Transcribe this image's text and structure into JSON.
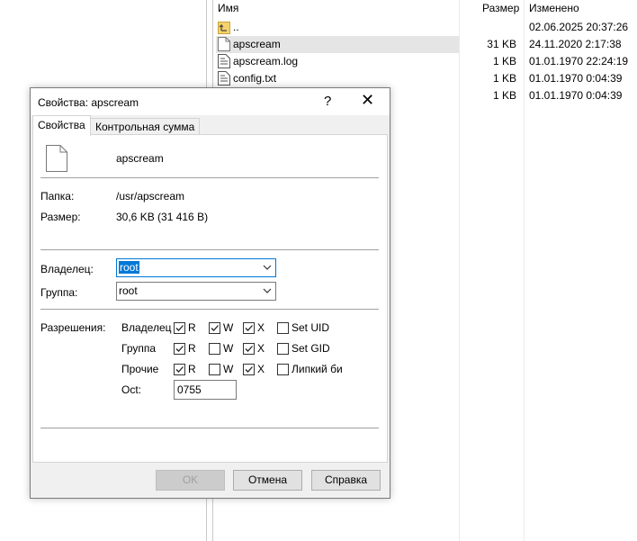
{
  "file_panel": {
    "headers": {
      "name": "Имя",
      "size": "Размер",
      "modified": "Изменено"
    },
    "files": [
      {
        "name": "..",
        "size": "",
        "modified": "02.06.2025 20:37:26",
        "icon": "parent-folder-icon"
      },
      {
        "name": "apscream",
        "size": "31 KB",
        "modified": "24.11.2020 2:17:38",
        "icon": "file-icon",
        "selected": true
      },
      {
        "name": "apscream.log",
        "size": "1 KB",
        "modified": "01.01.1970 22:24:19",
        "icon": "log-file-icon"
      },
      {
        "name": "config.txt",
        "size": "1 KB",
        "modified": "01.01.1970 0:04:39",
        "icon": "text-file-icon"
      },
      {
        "name": "",
        "size": "1 KB",
        "modified": "01.01.1970 0:04:39",
        "icon": ""
      }
    ]
  },
  "dialog": {
    "title": "Свойства: apscream",
    "help_glyph": "?",
    "close_glyph": "✕",
    "tabs": [
      "Свойства",
      "Контрольная сумма"
    ],
    "file_name": "apscream",
    "folder_label": "Папка:",
    "folder_value": "/usr/apscream",
    "size_label": "Размер:",
    "size_value": "30,6 KB (31 416 B)",
    "owner_label": "Владелец:",
    "owner_value": "root",
    "group_label": "Группа:",
    "group_value": "root",
    "permissions_label": "Разрешения:",
    "perm_rows": [
      {
        "label": "Владелец",
        "r": true,
        "w": true,
        "x": true,
        "extra_label": "Set UID",
        "extra": false
      },
      {
        "label": "Группа",
        "r": true,
        "w": false,
        "x": true,
        "extra_label": "Set GID",
        "extra": false
      },
      {
        "label": "Прочие",
        "r": true,
        "w": false,
        "x": true,
        "extra_label": "Липкий би",
        "extra": false
      }
    ],
    "perm_letters": {
      "r": "R",
      "w": "W",
      "x": "X"
    },
    "octal_label": "Oct:",
    "octal_value": "0755",
    "buttons": {
      "ok": "OK",
      "cancel": "Отмена",
      "help": "Справка"
    }
  }
}
